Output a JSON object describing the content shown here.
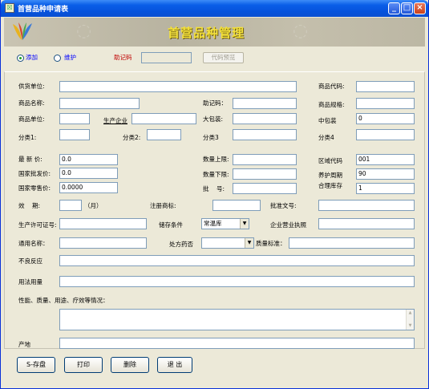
{
  "window": {
    "title": "首营品种申请表",
    "minimize": "_",
    "maximize": "□",
    "close": "×"
  },
  "banner": {
    "title": "首营品种管理"
  },
  "mode": {
    "add_label": "添加",
    "maintain_label": "维护",
    "mnemonic_label": "助记码",
    "mnemonic_value": "",
    "code_preview_label": "代码预览"
  },
  "form": {
    "supplier": {
      "label": "供货单位:",
      "value": ""
    },
    "product_code": {
      "label": "商品代码:",
      "value": ""
    },
    "product_name": {
      "label": "商品名称:",
      "value": ""
    },
    "mnemonic_code": {
      "label": "助记码：",
      "value": ""
    },
    "spec": {
      "label": "商品规格:",
      "value": ""
    },
    "unit": {
      "label": "商品单位:",
      "value": ""
    },
    "manufacturer": {
      "label": "生产企业",
      "value": ""
    },
    "large_pack": {
      "label": "大包装:",
      "value": ""
    },
    "medium_pack": {
      "label": "中包装",
      "value": "0"
    },
    "category1": {
      "label": "分类1:",
      "value": ""
    },
    "category2": {
      "label": "分类2:",
      "value": ""
    },
    "category3": {
      "label": "分类3",
      "value": ""
    },
    "category4": {
      "label": "分类4",
      "value": ""
    },
    "latest_price": {
      "label": "最 新 价:",
      "value": "0.0"
    },
    "qty_upper": {
      "label": "数量上限:",
      "value": ""
    },
    "region_code": {
      "label": "区域代码",
      "value": "001"
    },
    "wholesale_price": {
      "label": "国家批发价:",
      "value": "0.0"
    },
    "qty_lower": {
      "label": "数量下限:",
      "value": ""
    },
    "maintenance_cycle": {
      "label": "养护周期",
      "value": "90"
    },
    "retail_price": {
      "label": "国家零售价:",
      "value": "0.0000"
    },
    "batch_no": {
      "label": "批    号:",
      "value": ""
    },
    "reasonable_stock": {
      "label": "合理库存",
      "value": "1"
    },
    "validity": {
      "label": "效    期:",
      "value": "",
      "unit": "（月）"
    },
    "trademark": {
      "label": "注册商标:",
      "value": ""
    },
    "approval_no": {
      "label": "批准文号:",
      "value": ""
    },
    "production_license": {
      "label": "生产许可证号:",
      "value": ""
    },
    "storage": {
      "label": "储存条件",
      "value": "常温库"
    },
    "business_license": {
      "label": "企业营业执照",
      "value": ""
    },
    "generic_name": {
      "label": "通用名称：",
      "value": ""
    },
    "prescription": {
      "label": "处方药否",
      "value": ""
    },
    "quality_standard": {
      "label": "质量标准：",
      "value": ""
    },
    "adverse_reaction": {
      "label": "不良反应",
      "value": ""
    },
    "usage": {
      "label": "用法用量",
      "value": ""
    },
    "performance": {
      "label": "性能、质量、用途、疗效等情况：",
      "value": ""
    },
    "origin": {
      "label": "产地",
      "value": ""
    }
  },
  "buttons": {
    "save": "S-存盘",
    "print": "打印",
    "delete": "删除",
    "exit": "退  出"
  }
}
